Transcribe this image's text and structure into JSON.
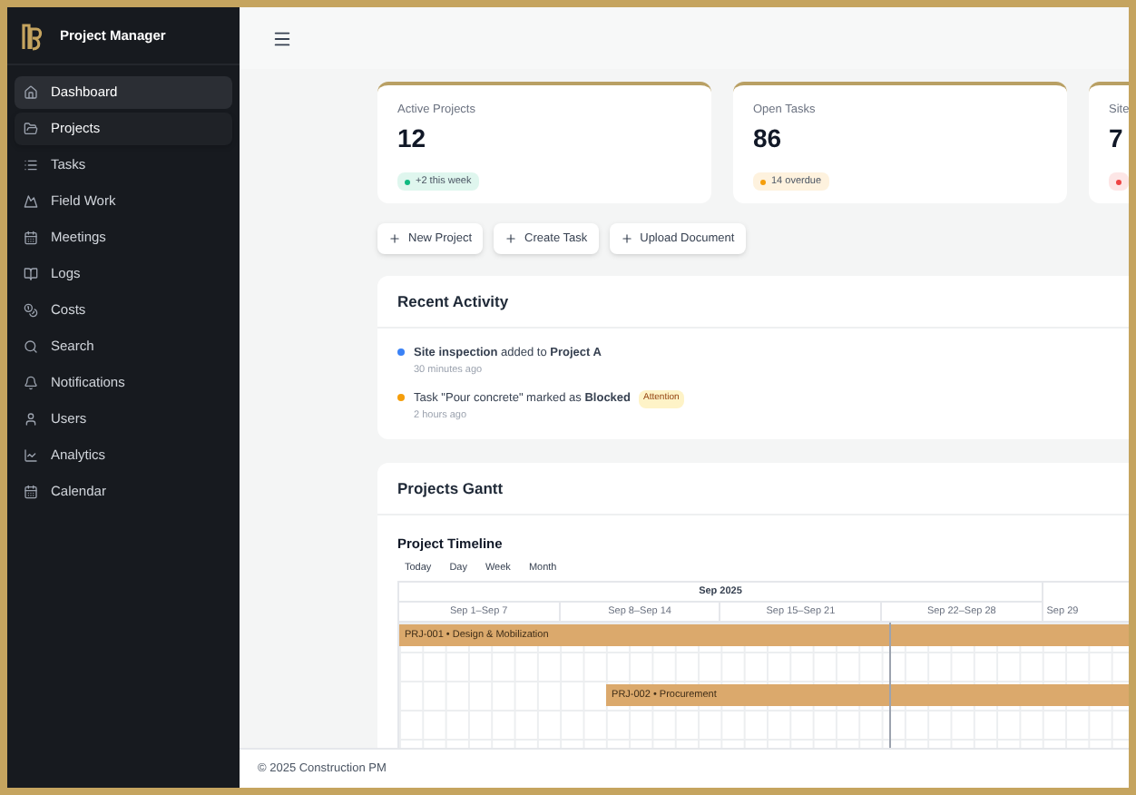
{
  "app": {
    "title": "Project Manager"
  },
  "sidebar": {
    "items": [
      {
        "label": "Dashboard",
        "selected": true,
        "hovered": false
      },
      {
        "label": "Projects",
        "selected": false,
        "hovered": true
      },
      {
        "label": "Tasks",
        "selected": false,
        "hovered": false
      },
      {
        "label": "Field Work",
        "selected": false,
        "hovered": false
      },
      {
        "label": "Meetings",
        "selected": false,
        "hovered": false
      },
      {
        "label": "Logs",
        "selected": false,
        "hovered": false
      },
      {
        "label": "Costs",
        "selected": false,
        "hovered": false
      },
      {
        "label": "Search",
        "selected": false,
        "hovered": false
      },
      {
        "label": "Notifications",
        "selected": false,
        "hovered": false
      },
      {
        "label": "Users",
        "selected": false,
        "hovered": false
      },
      {
        "label": "Analytics",
        "selected": false,
        "hovered": false
      },
      {
        "label": "Calendar",
        "selected": false,
        "hovered": false
      }
    ]
  },
  "stats": [
    {
      "label": "Active Projects",
      "value": "12",
      "badge": "+2 this week",
      "color": "#10b981"
    },
    {
      "label": "Open Tasks",
      "value": "86",
      "badge": "14 overdue",
      "color": "#f59e0b"
    },
    {
      "label": "Site",
      "value": "7",
      "color": "#ef4444"
    }
  ],
  "actions": [
    "New Project",
    "Create Task",
    "Upload Document"
  ],
  "recent_activity": {
    "title": "Recent Activity",
    "items": [
      {
        "text": "**Site inspection** added to **Project A**",
        "time": "30 minutes ago",
        "color": "#3b82f6"
      },
      {
        "text": "Task \"Pour concrete\" marked as **Blocked**",
        "time": "2 hours ago",
        "color": "#f59e0b",
        "tag": "Attention"
      }
    ]
  },
  "gantt": {
    "title": "Projects Gantt",
    "subtitle": "Project Timeline",
    "views": [
      "Today",
      "Day",
      "Week",
      "Month"
    ],
    "month": "Sep 2025",
    "weeks": [
      "Sep 1–Sep 7",
      "Sep 8–Sep 14",
      "Sep 15–Sep 21",
      "Sep 22–Sep 28",
      "Sep 29"
    ],
    "bars": [
      {
        "label": "PRJ-001 • Design & Mobilization"
      },
      {
        "label": "PRJ-002 • Procurement"
      }
    ]
  },
  "footer": "© 2025 Construction PM"
}
